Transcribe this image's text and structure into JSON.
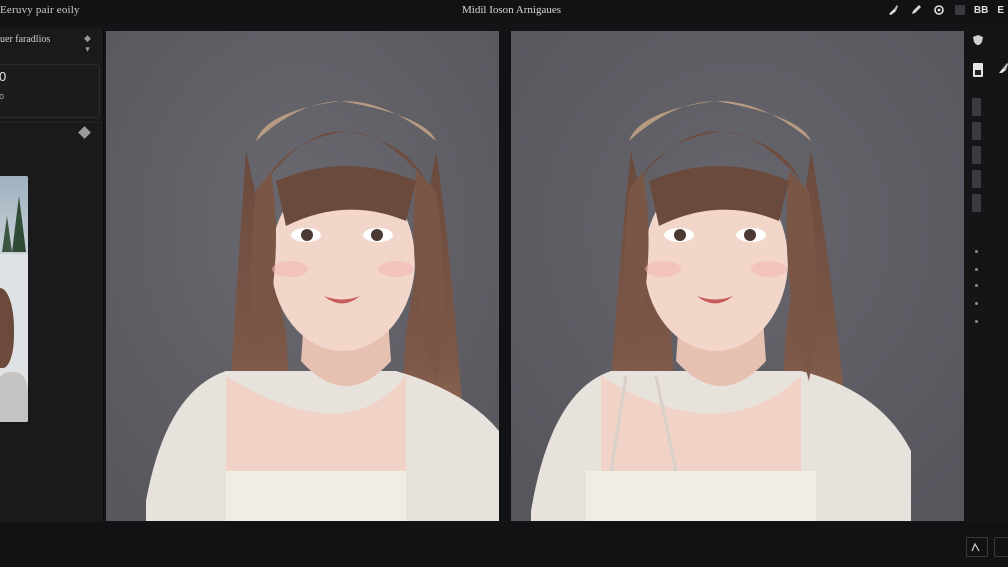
{
  "app": {
    "title": "Eeruvy pair eoily"
  },
  "document": {
    "title": "Midil Ioson Arnigaues"
  },
  "toolbar": {
    "icons": [
      "brush-icon",
      "pencil-icon",
      "circle-icon",
      "square-icon"
    ],
    "label": "BB",
    "corner_label": "E"
  },
  "left_panel": {
    "header": "uer faradlios",
    "value": "0",
    "sub": "o"
  },
  "right_panel": {
    "icons": [
      "shield-icon",
      "layer-icon",
      "brush-icon"
    ]
  },
  "colors": {
    "background": "#141416",
    "canvas": "#5c5b62",
    "panel": "#1a1a1d",
    "hair": "#6e4c3e",
    "skin": "#f0d3c6",
    "headband": "#b69b82",
    "shirt": "#e8e2dc"
  }
}
